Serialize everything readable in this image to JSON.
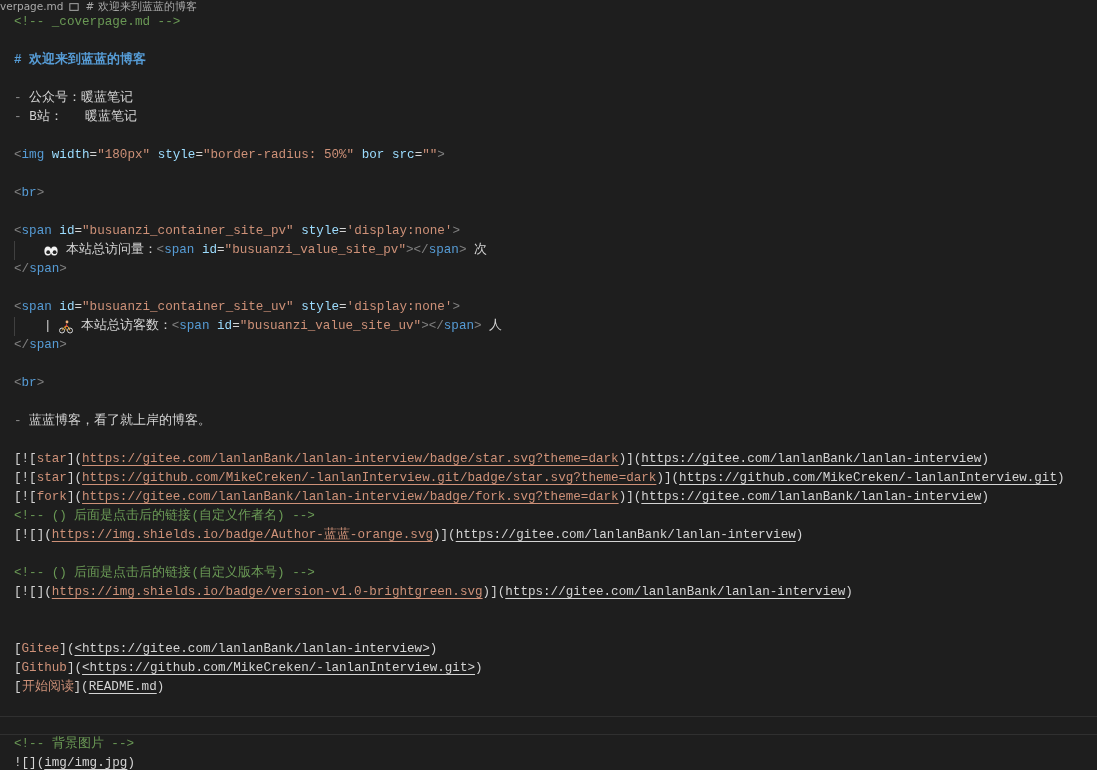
{
  "breadcrumb": [
    "verpage.md",
    "# 欢迎来到蓝蓝的博客"
  ],
  "lines": [
    {
      "kind": "code",
      "tokens": [
        {
          "kind": "comment",
          "text": "<!-- _coverpage.md -->"
        }
      ]
    },
    {
      "kind": "blank"
    },
    {
      "kind": "code",
      "tokens": [
        {
          "kind": "heading",
          "text": "# 欢迎来到蓝蓝的博客"
        }
      ]
    },
    {
      "kind": "blank"
    },
    {
      "kind": "code",
      "tokens": [
        {
          "kind": "marker",
          "text": "- "
        },
        {
          "kind": "plain",
          "text": "公众号：暖蓝笔记"
        }
      ]
    },
    {
      "kind": "code",
      "tokens": [
        {
          "kind": "marker",
          "text": "- "
        },
        {
          "kind": "plain",
          "text": "B站：   暖蓝笔记"
        }
      ]
    },
    {
      "kind": "blank"
    },
    {
      "kind": "code",
      "tokens": [
        {
          "kind": "punct",
          "text": "<"
        },
        {
          "kind": "tag",
          "text": "img"
        },
        {
          "kind": "attr",
          "text": " width"
        },
        {
          "kind": "plain",
          "text": "="
        },
        {
          "kind": "string",
          "text": "\"180px\""
        },
        {
          "kind": "attr",
          "text": " style"
        },
        {
          "kind": "plain",
          "text": "="
        },
        {
          "kind": "string",
          "text": "\"border-radius: 50%\""
        },
        {
          "kind": "attr",
          "text": " bor src"
        },
        {
          "kind": "plain",
          "text": "="
        },
        {
          "kind": "string",
          "text": "\"\""
        },
        {
          "kind": "punct",
          "text": ">"
        }
      ]
    },
    {
      "kind": "blank"
    },
    {
      "kind": "code",
      "tokens": [
        {
          "kind": "punct",
          "text": "<"
        },
        {
          "kind": "tag",
          "text": "br"
        },
        {
          "kind": "punct",
          "text": ">"
        }
      ]
    },
    {
      "kind": "blank"
    },
    {
      "kind": "code",
      "tokens": [
        {
          "kind": "punct",
          "text": "<"
        },
        {
          "kind": "tag",
          "text": "span"
        },
        {
          "kind": "attr",
          "text": " id"
        },
        {
          "kind": "plain",
          "text": "="
        },
        {
          "kind": "string",
          "text": "\"busuanzi_container_site_pv\""
        },
        {
          "kind": "attr",
          "text": " style"
        },
        {
          "kind": "plain",
          "text": "="
        },
        {
          "kind": "string",
          "text": "'display:none'"
        },
        {
          "kind": "punct",
          "text": ">"
        }
      ]
    },
    {
      "kind": "code",
      "tokens": [
        {
          "kind": "indent"
        },
        {
          "kind": "eyes"
        },
        {
          "kind": "plain",
          "text": " 本站总访问量："
        },
        {
          "kind": "punct",
          "text": "<"
        },
        {
          "kind": "tag",
          "text": "span"
        },
        {
          "kind": "attr",
          "text": " id"
        },
        {
          "kind": "plain",
          "text": "="
        },
        {
          "kind": "string",
          "text": "\"busuanzi_value_site_pv\""
        },
        {
          "kind": "punct",
          "text": "></"
        },
        {
          "kind": "tag",
          "text": "span"
        },
        {
          "kind": "punct",
          "text": ">"
        },
        {
          "kind": "plain",
          "text": " 次"
        }
      ]
    },
    {
      "kind": "code",
      "tokens": [
        {
          "kind": "punct",
          "text": "</"
        },
        {
          "kind": "tag",
          "text": "span"
        },
        {
          "kind": "punct",
          "text": ">"
        }
      ]
    },
    {
      "kind": "blank"
    },
    {
      "kind": "code",
      "tokens": [
        {
          "kind": "punct",
          "text": "<"
        },
        {
          "kind": "tag",
          "text": "span"
        },
        {
          "kind": "attr",
          "text": " id"
        },
        {
          "kind": "plain",
          "text": "="
        },
        {
          "kind": "string",
          "text": "\"busuanzi_container_site_uv\""
        },
        {
          "kind": "attr",
          "text": " style"
        },
        {
          "kind": "plain",
          "text": "="
        },
        {
          "kind": "string",
          "text": "'display:none'"
        },
        {
          "kind": "punct",
          "text": ">"
        }
      ]
    },
    {
      "kind": "code",
      "tokens": [
        {
          "kind": "indent"
        },
        {
          "kind": "plain",
          "text": "| "
        },
        {
          "kind": "bike"
        },
        {
          "kind": "plain",
          "text": " 本站总访客数："
        },
        {
          "kind": "punct",
          "text": "<"
        },
        {
          "kind": "tag",
          "text": "span"
        },
        {
          "kind": "attr",
          "text": " id"
        },
        {
          "kind": "plain",
          "text": "="
        },
        {
          "kind": "string",
          "text": "\"busuanzi_value_site_uv\""
        },
        {
          "kind": "punct",
          "text": "></"
        },
        {
          "kind": "tag",
          "text": "span"
        },
        {
          "kind": "punct",
          "text": ">"
        },
        {
          "kind": "plain",
          "text": " 人"
        }
      ]
    },
    {
      "kind": "code",
      "tokens": [
        {
          "kind": "punct",
          "text": "</"
        },
        {
          "kind": "tag",
          "text": "span"
        },
        {
          "kind": "punct",
          "text": ">"
        }
      ]
    },
    {
      "kind": "blank"
    },
    {
      "kind": "code",
      "tokens": [
        {
          "kind": "punct",
          "text": "<"
        },
        {
          "kind": "tag",
          "text": "br"
        },
        {
          "kind": "punct",
          "text": ">"
        }
      ]
    },
    {
      "kind": "blank"
    },
    {
      "kind": "code",
      "tokens": [
        {
          "kind": "marker",
          "text": "- "
        },
        {
          "kind": "plain",
          "text": "蓝蓝博客，看了就上岸的博客。"
        }
      ]
    },
    {
      "kind": "blank"
    },
    {
      "kind": "code",
      "tokens": [
        {
          "kind": "plain",
          "text": "[!["
        },
        {
          "kind": "linktext",
          "text": "star"
        },
        {
          "kind": "plain",
          "text": "]("
        },
        {
          "kind": "image_url",
          "text": "https://gitee.com/lanlanBank/lanlan-interview/badge/star.svg?theme=dark"
        },
        {
          "kind": "plain",
          "text": ")]("
        },
        {
          "kind": "url",
          "text": "https://gitee.com/lanlanBank/lanlan-interview"
        },
        {
          "kind": "plain",
          "text": ")"
        }
      ]
    },
    {
      "kind": "code",
      "tokens": [
        {
          "kind": "plain",
          "text": "[!["
        },
        {
          "kind": "linktext",
          "text": "star"
        },
        {
          "kind": "plain",
          "text": "]("
        },
        {
          "kind": "image_url",
          "text": "https://github.com/MikeCreken/-lanlanInterview.git/badge/star.svg?theme=dark"
        },
        {
          "kind": "plain",
          "text": ")]("
        },
        {
          "kind": "url",
          "text": "https://github.com/MikeCreken/-lanlanInterview.git"
        },
        {
          "kind": "plain",
          "text": ")"
        }
      ]
    },
    {
      "kind": "code",
      "tokens": [
        {
          "kind": "plain",
          "text": "[!["
        },
        {
          "kind": "linktext",
          "text": "fork"
        },
        {
          "kind": "plain",
          "text": "]("
        },
        {
          "kind": "image_url",
          "text": "https://gitee.com/lanlanBank/lanlan-interview/badge/fork.svg?theme=dark"
        },
        {
          "kind": "plain",
          "text": ")]("
        },
        {
          "kind": "url",
          "text": "https://gitee.com/lanlanBank/lanlan-interview"
        },
        {
          "kind": "plain",
          "text": ")"
        }
      ]
    },
    {
      "kind": "code",
      "tokens": [
        {
          "kind": "comment",
          "text": "<!-- () 后面是点击后的链接(自定义作者名) -->"
        }
      ]
    },
    {
      "kind": "code",
      "tokens": [
        {
          "kind": "plain",
          "text": "[![]("
        },
        {
          "kind": "image_url",
          "text": "https://img.shields.io/badge/Author-蓝蓝-orange.svg"
        },
        {
          "kind": "plain",
          "text": ")]("
        },
        {
          "kind": "url",
          "text": "https://gitee.com/lanlanBank/lanlan-interview"
        },
        {
          "kind": "plain",
          "text": ")"
        }
      ]
    },
    {
      "kind": "blank"
    },
    {
      "kind": "code",
      "tokens": [
        {
          "kind": "comment",
          "text": "<!-- () 后面是点击后的链接(自定义版本号) -->"
        }
      ]
    },
    {
      "kind": "code",
      "tokens": [
        {
          "kind": "plain",
          "text": "[![]("
        },
        {
          "kind": "image_url",
          "text": "https://img.shields.io/badge/version-v1.0-brightgreen.svg"
        },
        {
          "kind": "plain",
          "text": ")]("
        },
        {
          "kind": "url",
          "text": "https://gitee.com/lanlanBank/lanlan-interview"
        },
        {
          "kind": "plain",
          "text": ")"
        }
      ]
    },
    {
      "kind": "blank"
    },
    {
      "kind": "blank"
    },
    {
      "kind": "code",
      "tokens": [
        {
          "kind": "plain",
          "text": "["
        },
        {
          "kind": "linktext",
          "text": "Gitee"
        },
        {
          "kind": "plain",
          "text": "]("
        },
        {
          "kind": "url",
          "text": "<https://gitee.com/lanlanBank/lanlan-interview>"
        },
        {
          "kind": "plain",
          "text": ")"
        }
      ]
    },
    {
      "kind": "code",
      "tokens": [
        {
          "kind": "plain",
          "text": "["
        },
        {
          "kind": "linktext",
          "text": "Github"
        },
        {
          "kind": "plain",
          "text": "]("
        },
        {
          "kind": "url",
          "text": "<https://github.com/MikeCreken/-lanlanInterview.git>"
        },
        {
          "kind": "plain",
          "text": ")"
        }
      ]
    },
    {
      "kind": "code",
      "tokens": [
        {
          "kind": "plain",
          "text": "["
        },
        {
          "kind": "linktext",
          "text": "开始阅读"
        },
        {
          "kind": "plain",
          "text": "]("
        },
        {
          "kind": "url",
          "text": "README.md"
        },
        {
          "kind": "plain",
          "text": ")"
        }
      ]
    },
    {
      "kind": "blank"
    },
    {
      "kind": "current"
    },
    {
      "kind": "code",
      "tokens": [
        {
          "kind": "comment",
          "text": "<!-- 背景图片 -->"
        }
      ]
    },
    {
      "kind": "code",
      "tokens": [
        {
          "kind": "plain",
          "text": "![]("
        },
        {
          "kind": "url",
          "text": "img/img.jpg"
        },
        {
          "kind": "plain",
          "text": ")"
        }
      ]
    }
  ]
}
